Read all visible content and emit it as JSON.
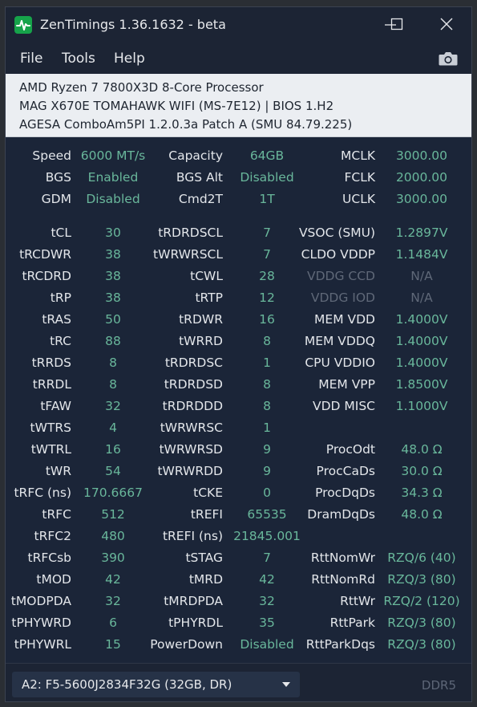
{
  "window": {
    "title": "ZenTimings 1.36.1632 - beta"
  },
  "menu": {
    "items": [
      "File",
      "Tools",
      "Help"
    ]
  },
  "icons": {
    "app": "activity-pulse-icon",
    "screenshot": "camera-icon",
    "minimize": "minimize-icon",
    "maximize": "maximize-icon",
    "close": "close-icon",
    "dropdown": "chevron-down-icon"
  },
  "colors": {
    "background": "#1b2538",
    "value": "#69b79b",
    "label": "#e3e6ea",
    "disabled": "#5f6878",
    "app_icon": "#16a34a",
    "info_bg": "#ebeef2"
  },
  "system": {
    "cpu": "AMD Ryzen 7 7800X3D 8-Core Processor",
    "board": "MAG X670E TOMAHAWK WIFI (MS-7E12) | BIOS 1.H2",
    "agesa": "AGESA ComboAm5PI 1.2.0.3a Patch A (SMU 84.79.225)"
  },
  "summary": [
    [
      [
        "Speed",
        "6000 MT/s"
      ],
      [
        "Capacity",
        "64GB"
      ],
      [
        "MCLK",
        "3000.00"
      ]
    ],
    [
      [
        "BGS",
        "Enabled"
      ],
      [
        "BGS Alt",
        "Disabled"
      ],
      [
        "FCLK",
        "2000.00"
      ]
    ],
    [
      [
        "GDM",
        "Disabled"
      ],
      [
        "Cmd2T",
        "1T"
      ],
      [
        "UCLK",
        "3000.00"
      ]
    ]
  ],
  "timings": [
    [
      [
        "tCL",
        "30"
      ],
      [
        "tRDRDSCL",
        "7"
      ],
      [
        "VSOC (SMU)",
        "1.2897V"
      ]
    ],
    [
      [
        "tRCDWR",
        "38"
      ],
      [
        "tWRWRSCL",
        "7"
      ],
      [
        "CLDO VDDP",
        "1.1484V"
      ]
    ],
    [
      [
        "tRCDRD",
        "38"
      ],
      [
        "tCWL",
        "28"
      ],
      [
        "VDDG CCD",
        "N/A"
      ]
    ],
    [
      [
        "tRP",
        "38"
      ],
      [
        "tRTP",
        "12"
      ],
      [
        "VDDG IOD",
        "N/A"
      ]
    ],
    [
      [
        "tRAS",
        "50"
      ],
      [
        "tRDWR",
        "16"
      ],
      [
        "MEM VDD",
        "1.4000V"
      ]
    ],
    [
      [
        "tRC",
        "88"
      ],
      [
        "tWRRD",
        "8"
      ],
      [
        "MEM VDDQ",
        "1.4000V"
      ]
    ],
    [
      [
        "tRRDS",
        "8"
      ],
      [
        "tRDRDSC",
        "1"
      ],
      [
        "CPU VDDIO",
        "1.4000V"
      ]
    ],
    [
      [
        "tRRDL",
        "8"
      ],
      [
        "tRDRDSD",
        "8"
      ],
      [
        "MEM VPP",
        "1.8500V"
      ]
    ],
    [
      [
        "tFAW",
        "32"
      ],
      [
        "tRDRDDD",
        "8"
      ],
      [
        "VDD MISC",
        "1.1000V"
      ]
    ],
    [
      [
        "tWTRS",
        "4"
      ],
      [
        "tWRWRSC",
        "1"
      ],
      [
        "",
        ""
      ]
    ],
    [
      [
        "tWTRL",
        "16"
      ],
      [
        "tWRWRSD",
        "9"
      ],
      [
        "ProcOdt",
        "48.0 Ω"
      ]
    ],
    [
      [
        "tWR",
        "54"
      ],
      [
        "tWRWRDD",
        "9"
      ],
      [
        "ProcCaDs",
        "30.0 Ω"
      ]
    ],
    [
      [
        "tRFC (ns)",
        "170.6667"
      ],
      [
        "tCKE",
        "0"
      ],
      [
        "ProcDqDs",
        "34.3 Ω"
      ]
    ],
    [
      [
        "tRFC",
        "512"
      ],
      [
        "tREFI",
        "65535"
      ],
      [
        "DramDqDs",
        "48.0 Ω"
      ]
    ],
    [
      [
        "tRFC2",
        "480"
      ],
      [
        "tREFI (ns)",
        "21845.001"
      ],
      [
        "",
        ""
      ]
    ],
    [
      [
        "tRFCsb",
        "390"
      ],
      [
        "tSTAG",
        "7"
      ],
      [
        "RttNomWr",
        "RZQ/6 (40)"
      ]
    ],
    [
      [
        "tMOD",
        "42"
      ],
      [
        "tMRD",
        "42"
      ],
      [
        "RttNomRd",
        "RZQ/3 (80)"
      ]
    ],
    [
      [
        "tMODPDA",
        "32"
      ],
      [
        "tMRDPDA",
        "32"
      ],
      [
        "RttWr",
        "RZQ/2 (120)"
      ]
    ],
    [
      [
        "tPHYWRD",
        "6"
      ],
      [
        "tPHYRDL",
        "35"
      ],
      [
        "RttPark",
        "RZQ/3 (80)"
      ]
    ],
    [
      [
        "tPHYWRL",
        "15"
      ],
      [
        "PowerDown",
        "Disabled"
      ],
      [
        "RttParkDqs",
        "RZQ/3 (80)"
      ]
    ]
  ],
  "disabled_labels": [
    "VDDG CCD",
    "VDDG IOD"
  ],
  "footer": {
    "dimm": "A2: F5-5600J2834F32G (32GB, DR)",
    "ddr": "DDR5"
  }
}
